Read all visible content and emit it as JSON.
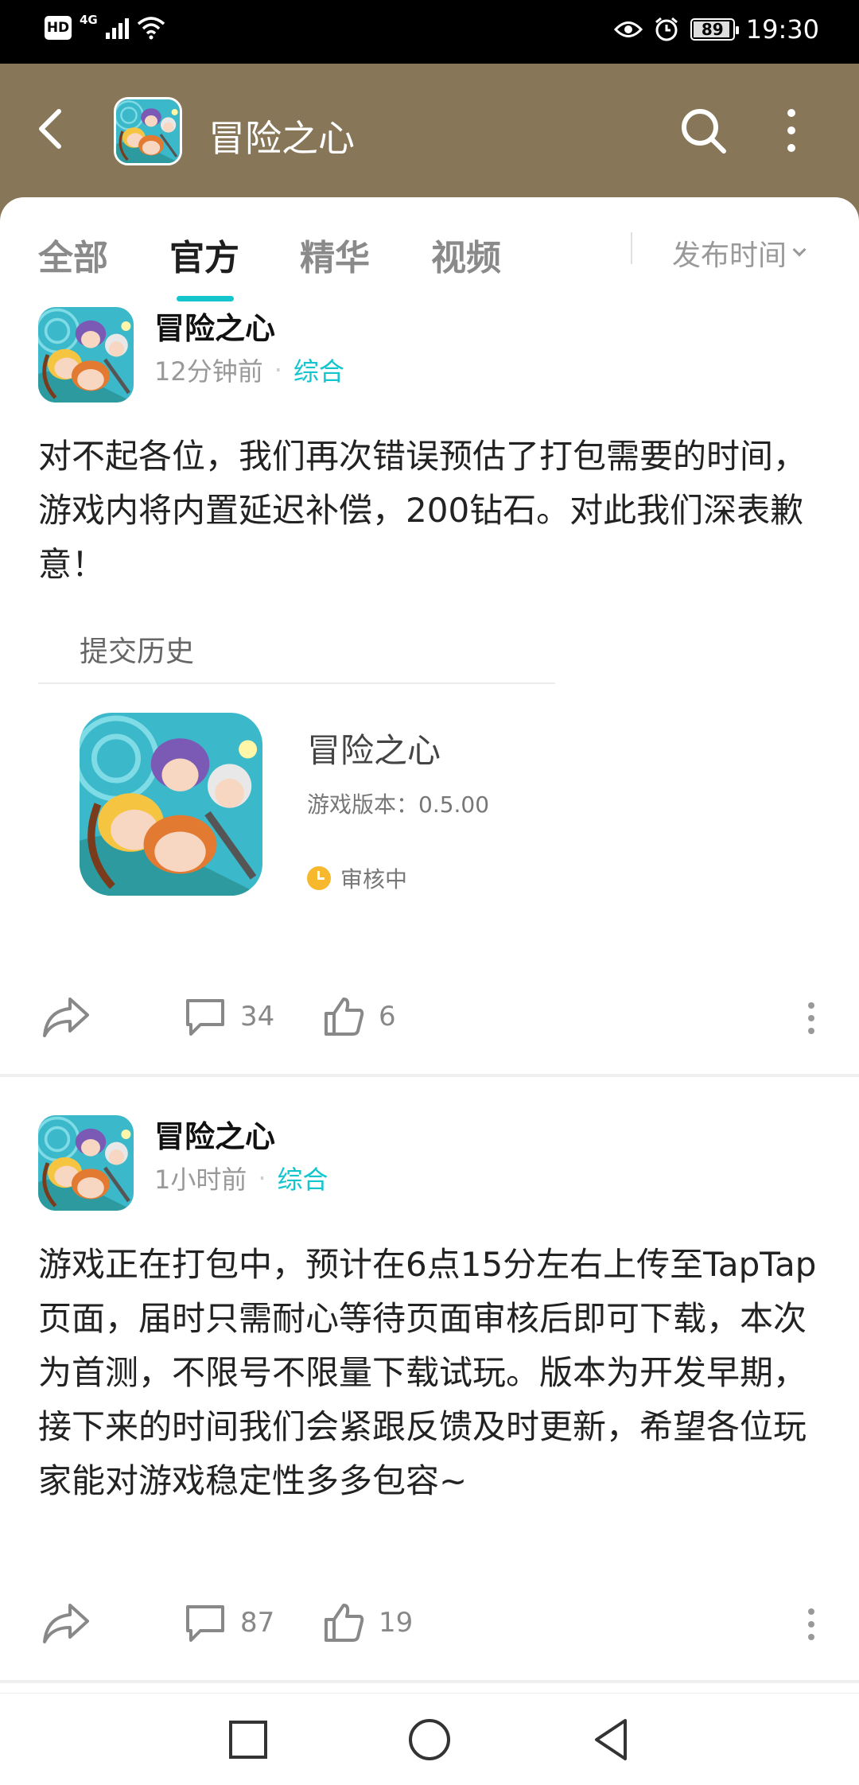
{
  "status_bar": {
    "hd": "HD",
    "network": "4G",
    "battery": "89",
    "time": "19:30"
  },
  "header": {
    "title": "冒险之心"
  },
  "tabs": [
    {
      "label": "全部"
    },
    {
      "label": "官方"
    },
    {
      "label": "精华"
    },
    {
      "label": "视频"
    }
  ],
  "active_tab": "官方",
  "sort": {
    "label": "发布时间"
  },
  "posts": [
    {
      "author": "冒险之心",
      "time": "12分钟前",
      "category": "综合",
      "body": "对不起各位，我们再次错误预估了打包需要的时间，游戏内将内置延迟补偿，200钻石。对此我们深表歉意！",
      "history_label": "提交历史",
      "card": {
        "name": "冒险之心",
        "version": "游戏版本：0.5.00",
        "status": "审核中"
      },
      "comments": "34",
      "likes": "6"
    },
    {
      "author": "冒险之心",
      "time": "1小时前",
      "category": "综合",
      "body": "游戏正在打包中，预计在6点15分左右上传至TapTap页面，届时只需耐心等待页面审核后即可下载，本次为首测，不限号不限量下载试玩。版本为开发早期，接下来的时间我们会紧跟反馈及时更新，希望各位玩家能对游戏稳定性多多包容~",
      "comments": "87",
      "likes": "19"
    }
  ],
  "colors": {
    "header_bg": "#877758",
    "accent": "#15c5ce",
    "status_pending": "#f7b82e"
  },
  "icons": [
    "back-arrow-icon",
    "search-icon",
    "more-vertical-icon",
    "share-icon",
    "comment-icon",
    "thumbs-up-icon",
    "clock-icon",
    "nav-square-icon",
    "nav-circle-icon",
    "nav-triangle-icon"
  ]
}
